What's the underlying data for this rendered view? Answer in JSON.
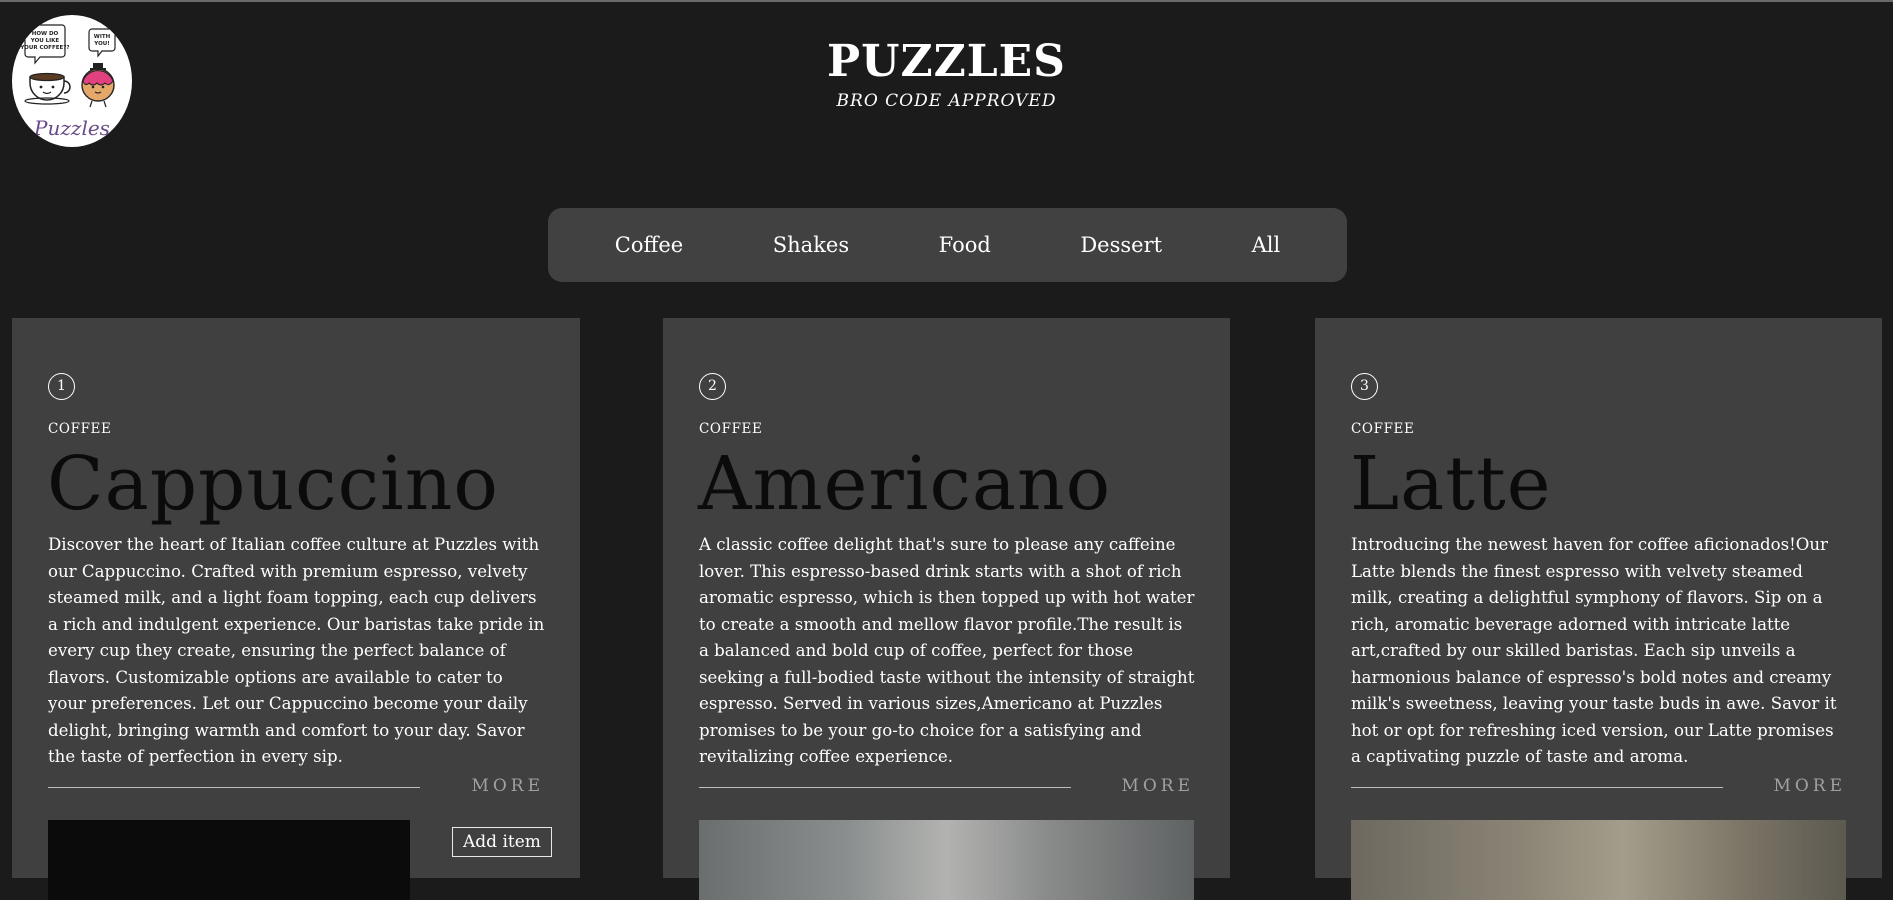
{
  "header": {
    "logo": {
      "alt": "Puzzles logo",
      "bubble_left": [
        "HOW DO",
        "YOU LIKE",
        "YOUR COFFEE??"
      ],
      "bubble_right": [
        "WITH",
        "YOU!"
      ],
      "script_text": "Puzzles"
    },
    "title": "PUZZLES",
    "subtitle": "BRO CODE APPROVED"
  },
  "nav": {
    "items": [
      {
        "label": "Coffee"
      },
      {
        "label": "Shakes"
      },
      {
        "label": "Food"
      },
      {
        "label": "Dessert"
      },
      {
        "label": "All"
      }
    ]
  },
  "cards": [
    {
      "number": "1",
      "category": "COFFEE",
      "title": "Cappuccino",
      "description": "Discover the heart of Italian coffee culture at Puzzles with our Cappuccino. Crafted with premium espresso, velvety steamed milk, and a light foam topping, each cup delivers a rich and indulgent experience. Our baristas take pride in every cup they create, ensuring the perfect balance of flavors. Customizable options are available to cater to your preferences. Let our Cappuccino become your daily delight, bringing warmth and comfort to your day. Savor the taste of perfection in every sip.",
      "more_label": "MORE",
      "add_label": "Add item"
    },
    {
      "number": "2",
      "category": "COFFEE",
      "title": "Americano",
      "description": "A classic coffee delight that's sure to please any caffeine lover. This espresso-based drink starts with a shot of rich aromatic espresso, which is then topped up with hot water to create a smooth and mellow flavor profile.The result is a balanced and bold cup of coffee, perfect for those seeking a full-bodied taste without the intensity of straight espresso. Served in various sizes,Americano at Puzzles promises to be your go-to choice for a satisfying and revitalizing coffee experience.",
      "more_label": "MORE"
    },
    {
      "number": "3",
      "category": "COFFEE",
      "title": "Latte",
      "description": "Introducing the newest haven for coffee aficionados!Our Latte blends the finest espresso with velvety steamed milk, creating a delightful symphony of flavors. Sip on a rich, aromatic beverage adorned with intricate latte art,crafted by our skilled baristas. Each sip unveils a harmonious balance of espresso's bold notes and creamy milk's sweetness, leaving your taste buds in awe. Savor it hot or opt for refreshing iced version, our Latte promises a captivating puzzle of taste and aroma.",
      "more_label": "MORE"
    }
  ]
}
